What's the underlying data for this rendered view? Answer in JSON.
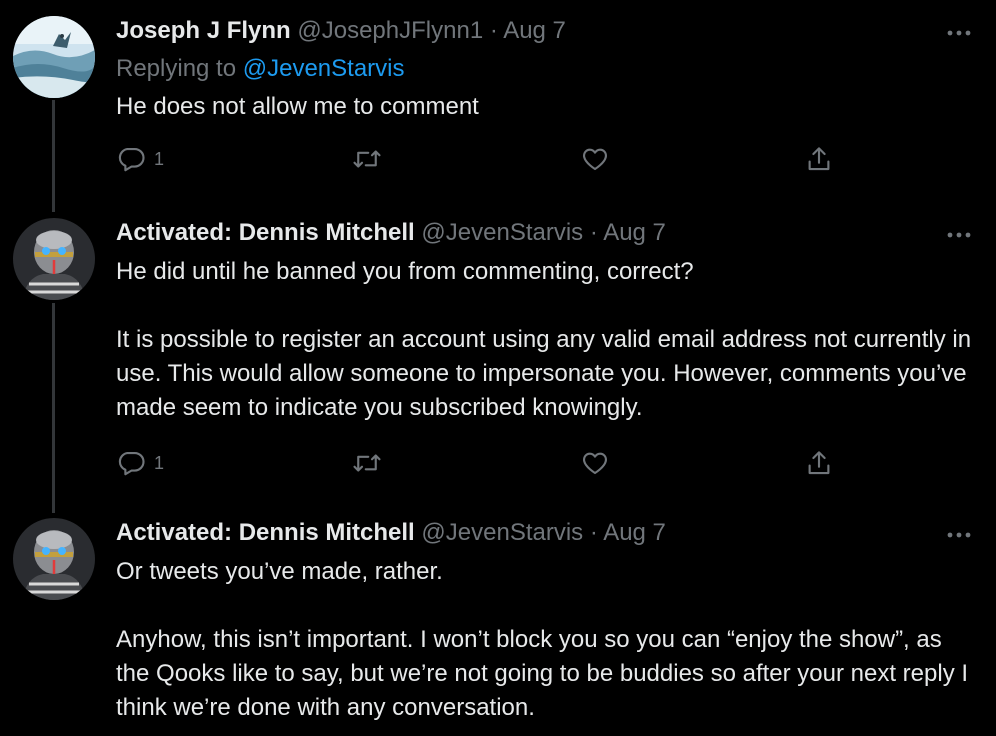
{
  "tweets": [
    {
      "author_name": "Joseph J Flynn",
      "handle": "@JosephJFlynn1",
      "separator": "·",
      "date": "Aug 7",
      "replying_prefix": "Replying to",
      "replying_handle": "@JevenStarvis",
      "paragraphs": [
        "He does not allow me to comment"
      ],
      "reply_count": "1"
    },
    {
      "author_name": "Activated: Dennis Mitchell",
      "handle": "@JevenStarvis",
      "separator": "·",
      "date": "Aug 7",
      "paragraphs": [
        "He did until he banned you from commenting, correct?",
        "It is possible to register an account using any valid email address not currently in use. This would allow someone to impersonate you. However, comments you’ve made seem to indicate you subscribed knowingly."
      ],
      "reply_count": "1"
    },
    {
      "author_name": "Activated: Dennis Mitchell",
      "handle": "@JevenStarvis",
      "separator": "·",
      "date": "Aug 7",
      "paragraphs": [
        "Or tweets you’ve made, rather.",
        "Anyhow, this isn’t important. I won’t block you so you can “enjoy the show”, as the Qooks like to say, but we’re not going to be buddies so after your next reply I think we’re done with any conversation."
      ]
    }
  ],
  "icons": {
    "reply": "reply-icon",
    "retweet": "retweet-icon",
    "like": "like-icon",
    "share": "share-icon",
    "more": "more-icon"
  },
  "colors": {
    "background": "#000000",
    "text": "#e7e9ea",
    "muted": "#71767b",
    "link": "#1d9bf0",
    "thread_line": "#333639"
  }
}
